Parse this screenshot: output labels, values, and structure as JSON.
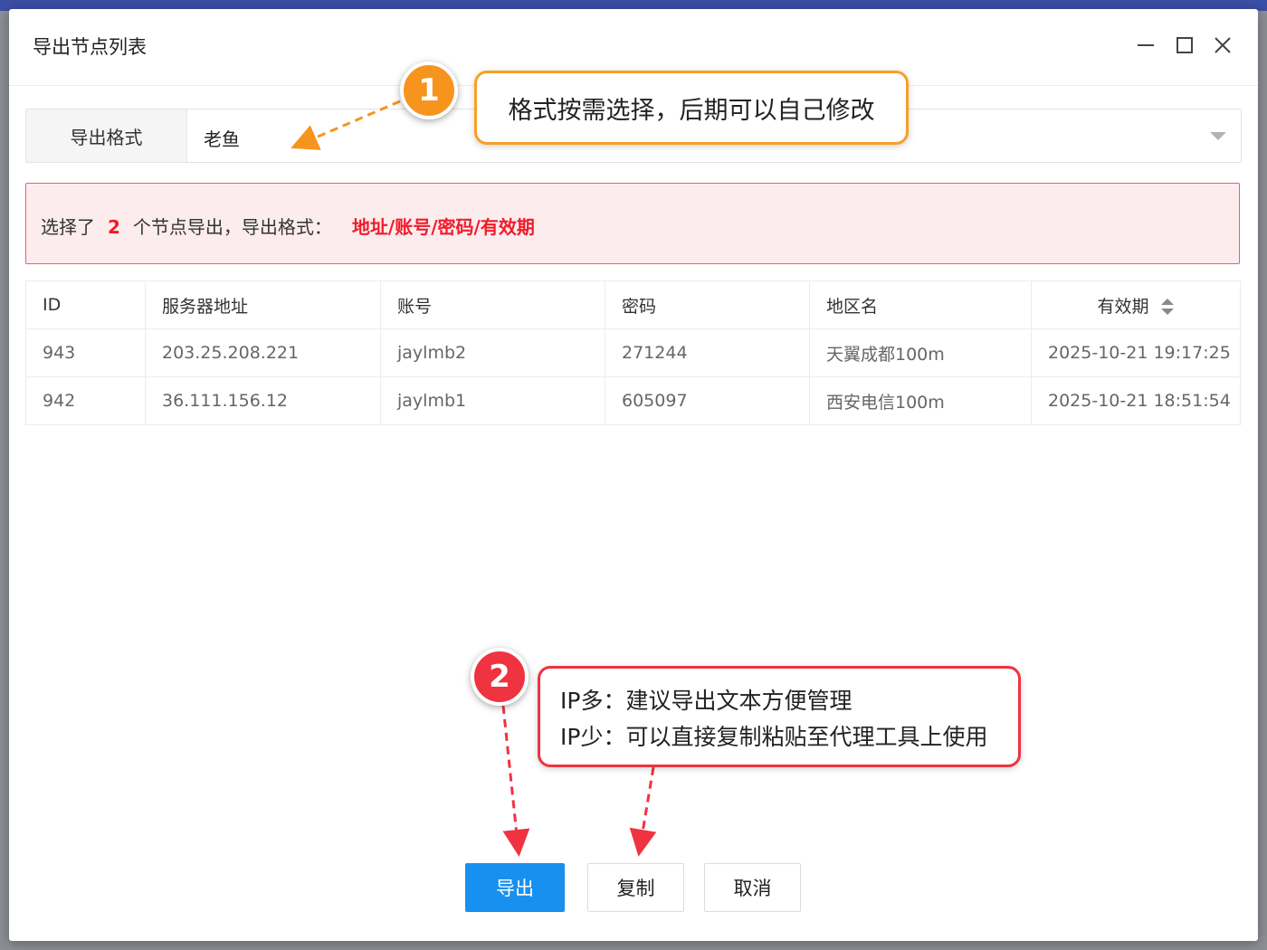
{
  "dialog": {
    "title": "导出节点列表"
  },
  "format": {
    "label": "导出格式",
    "value": "老鱼"
  },
  "alert": {
    "prefix": "选择了",
    "count": "2",
    "suffix": "个节点导出，导出格式：",
    "format_text": "地址/账号/密码/有效期"
  },
  "table": {
    "headers": [
      "ID",
      "服务器地址",
      "账号",
      "密码",
      "地区名",
      "有效期"
    ],
    "rows": [
      [
        "943",
        "203.25.208.221",
        "jaylmb2",
        "271244",
        "天翼成都100m",
        "2025-10-21 19:17:25"
      ],
      [
        "942",
        "36.111.156.12",
        "jaylmb1",
        "605097",
        "西安电信100m",
        "2025-10-21 18:51:54"
      ]
    ]
  },
  "buttons": {
    "export": "导出",
    "copy": "复制",
    "cancel": "取消"
  },
  "annotations": {
    "badge1": "1",
    "callout1": "格式按需选择，后期可以自己修改",
    "badge2": "2",
    "callout2_line1": "IP多：建议导出文本方便管理",
    "callout2_line2": "IP少：可以直接复制粘贴至代理工具上使用"
  },
  "colors": {
    "primary": "#1890f0",
    "alert_red": "#ef1c2a",
    "orange": "#f7941d",
    "annotation_red": "#ef3340"
  },
  "icons": [
    "minimize-icon",
    "maximize-icon",
    "close-icon",
    "chevron-down-icon",
    "sort-icon"
  ]
}
